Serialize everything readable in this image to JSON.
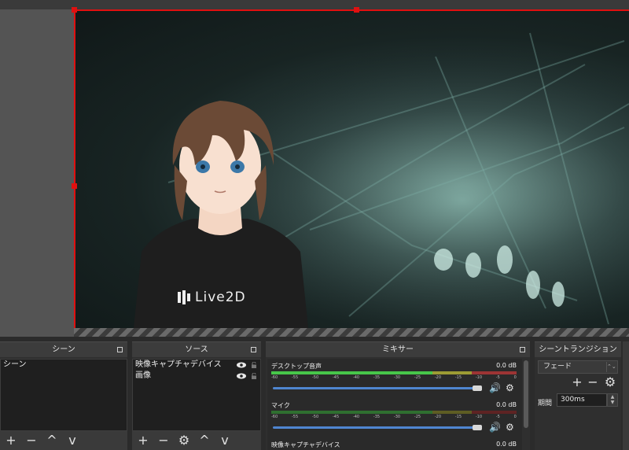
{
  "preview": {
    "logo_text": "Live2D"
  },
  "scenes": {
    "title": "シーン",
    "items": [
      "シーン"
    ]
  },
  "sources": {
    "title": "ソース",
    "items": [
      "映像キャプチャデバイス",
      "画像"
    ]
  },
  "mixer": {
    "title": "ミキサー",
    "tracks": [
      {
        "name": "デスクトップ音声",
        "db": "0.0 dB"
      },
      {
        "name": "マイク",
        "db": "0.0 dB"
      },
      {
        "name": "映像キャプチャデバイス",
        "db": "0.0 dB"
      }
    ],
    "scale": [
      "-60",
      "-55",
      "-50",
      "-45",
      "-40",
      "-35",
      "-30",
      "-25",
      "-20",
      "-15",
      "-10",
      "-5",
      "0"
    ]
  },
  "transitions": {
    "title": "シーントランジション",
    "selected": "フェード",
    "period_label": "期間",
    "period_value": "300ms"
  },
  "colors": {
    "selection_border": "#e01010",
    "meter_green": "#47c64a",
    "meter_yellow": "#9c9b34",
    "meter_red": "#9c3434",
    "fader_blue": "#4f86d0"
  }
}
